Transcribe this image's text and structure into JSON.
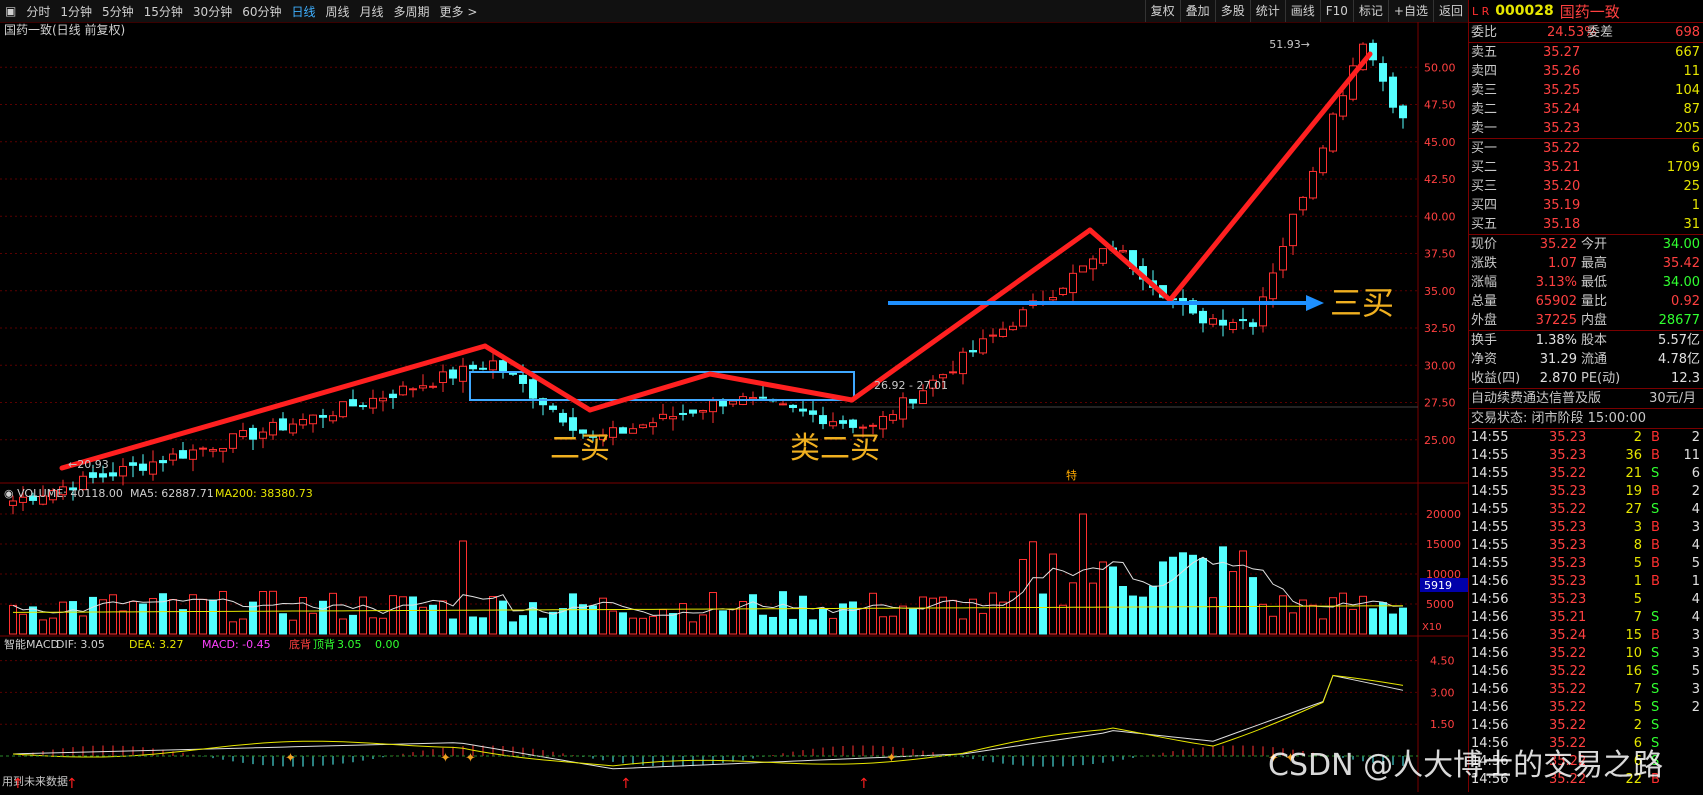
{
  "toolbar": {
    "periods": [
      "分时",
      "1分钟",
      "5分钟",
      "15分钟",
      "30分钟",
      "60分钟",
      "日线",
      "周线",
      "月线",
      "多周期",
      "更多 >"
    ],
    "active": "日线",
    "right": [
      "复权",
      "叠加",
      "多股",
      "统计",
      "画线",
      "F10",
      "标记",
      "+自选",
      "返回"
    ]
  },
  "main_chart": {
    "title": "国药一致(日线 前复权)",
    "y_ticks": [
      "50.00",
      "47.50",
      "45.00",
      "42.50",
      "40.00",
      "37.50",
      "35.00",
      "32.50",
      "30.00",
      "27.50",
      "25.00"
    ],
    "high_label": "51.93",
    "low_label": "20.93",
    "range_label": "26.92 - 27.01",
    "annotations": [
      "二买",
      "类二买",
      "三买"
    ],
    "marker": "特"
  },
  "volume_panel": {
    "label": "VOLUME: 40118.00",
    "ma5": "MA5: 62887.71",
    "ma200": "MA200: 38380.73",
    "y_ticks": [
      "20000",
      "15000",
      "10000",
      "5000"
    ],
    "current": "5919",
    "unit": "X10"
  },
  "macd_panel": {
    "name": "智能MACD",
    "dif": "DIF: 3.05",
    "dea": "DEA: 3.27",
    "macd": "MACD: -0.45",
    "bottom_div": "底背",
    "top_div": "顶背",
    "v1": "3.05",
    "v2": "0.00",
    "y_ticks": [
      "4.50",
      "3.00",
      "1.50"
    ],
    "footer": "用到未来数据"
  },
  "side": {
    "code": "000028",
    "name": "国药一致",
    "weibi_label": "委比",
    "weibi": "24.53%",
    "weicha_label": "委差",
    "weicha": "698",
    "sells": [
      {
        "label": "卖五",
        "price": "35.27",
        "vol": "667"
      },
      {
        "label": "卖四",
        "price": "35.26",
        "vol": "11"
      },
      {
        "label": "卖三",
        "price": "35.25",
        "vol": "104"
      },
      {
        "label": "卖二",
        "price": "35.24",
        "vol": "87"
      },
      {
        "label": "卖一",
        "price": "35.23",
        "vol": "205"
      }
    ],
    "buys": [
      {
        "label": "买一",
        "price": "35.22",
        "vol": "6"
      },
      {
        "label": "买二",
        "price": "35.21",
        "vol": "1709"
      },
      {
        "label": "买三",
        "price": "35.20",
        "vol": "25"
      },
      {
        "label": "买四",
        "price": "35.19",
        "vol": "1"
      },
      {
        "label": "买五",
        "price": "35.18",
        "vol": "31"
      }
    ],
    "stats": [
      {
        "l1": "现价",
        "v1": "35.22",
        "l2": "今开",
        "v2": "34.00"
      },
      {
        "l1": "涨跌",
        "v1": "1.07",
        "l2": "最高",
        "v2": "35.42"
      },
      {
        "l1": "涨幅",
        "v1": "3.13%",
        "l2": "最低",
        "v2": "34.00"
      },
      {
        "l1": "总量",
        "v1": "65902",
        "l2": "量比",
        "v2": "0.92"
      },
      {
        "l1": "外盘",
        "v1": "37225",
        "l2": "内盘",
        "v2": "28677"
      }
    ],
    "info": [
      {
        "l1": "换手",
        "v1": "1.38%",
        "l2": "股本",
        "v2": "5.57亿"
      },
      {
        "l1": "净资",
        "v1": "31.29",
        "l2": "流通",
        "v2": "4.78亿"
      },
      {
        "l1": "收益(四)",
        "v1": "2.870",
        "l2": "PE(动)",
        "v2": "12.3"
      }
    ],
    "promo": "自动续费通达信普及版",
    "promo_price": "30元/月",
    "status": "交易状态: 闭市阶段 15:00:00",
    "ticks": [
      {
        "t": "14:55",
        "p": "35.23",
        "v": "2",
        "d": "B",
        "n": "2"
      },
      {
        "t": "14:55",
        "p": "35.23",
        "v": "36",
        "d": "B",
        "n": "11"
      },
      {
        "t": "14:55",
        "p": "35.22",
        "v": "21",
        "d": "S",
        "n": "6"
      },
      {
        "t": "14:55",
        "p": "35.23",
        "v": "19",
        "d": "B",
        "n": "2"
      },
      {
        "t": "14:55",
        "p": "35.22",
        "v": "27",
        "d": "S",
        "n": "4"
      },
      {
        "t": "14:55",
        "p": "35.23",
        "v": "3",
        "d": "B",
        "n": "3"
      },
      {
        "t": "14:55",
        "p": "35.23",
        "v": "8",
        "d": "B",
        "n": "4"
      },
      {
        "t": "14:55",
        "p": "35.23",
        "v": "5",
        "d": "B",
        "n": "5"
      },
      {
        "t": "14:56",
        "p": "35.23",
        "v": "1",
        "d": "B",
        "n": "1"
      },
      {
        "t": "14:56",
        "p": "35.23",
        "v": "5",
        "d": "",
        "n": "4"
      },
      {
        "t": "14:56",
        "p": "35.21",
        "v": "7",
        "d": "S",
        "n": "4"
      },
      {
        "t": "14:56",
        "p": "35.24",
        "v": "15",
        "d": "B",
        "n": "3"
      },
      {
        "t": "14:56",
        "p": "35.22",
        "v": "10",
        "d": "S",
        "n": "3"
      },
      {
        "t": "14:56",
        "p": "35.22",
        "v": "16",
        "d": "S",
        "n": "5"
      },
      {
        "t": "14:56",
        "p": "35.22",
        "v": "7",
        "d": "S",
        "n": "3"
      },
      {
        "t": "14:56",
        "p": "35.22",
        "v": "5",
        "d": "S",
        "n": "2"
      },
      {
        "t": "14:56",
        "p": "35.22",
        "v": "2",
        "d": "S",
        "n": ""
      },
      {
        "t": "14:56",
        "p": "35.22",
        "v": "6",
        "d": "S",
        "n": ""
      },
      {
        "t": "14:56",
        "p": "35.22",
        "v": "6",
        "d": "S",
        "n": ""
      },
      {
        "t": "14:56",
        "p": "35.22",
        "v": "22",
        "d": "B",
        "n": ""
      }
    ]
  },
  "watermark": "CSDN @人大博士的交易之路",
  "colors": {
    "up": "#ff3030",
    "down": "#54ffff",
    "accent": "#3fb0ff",
    "gold": "#f0b020"
  }
}
